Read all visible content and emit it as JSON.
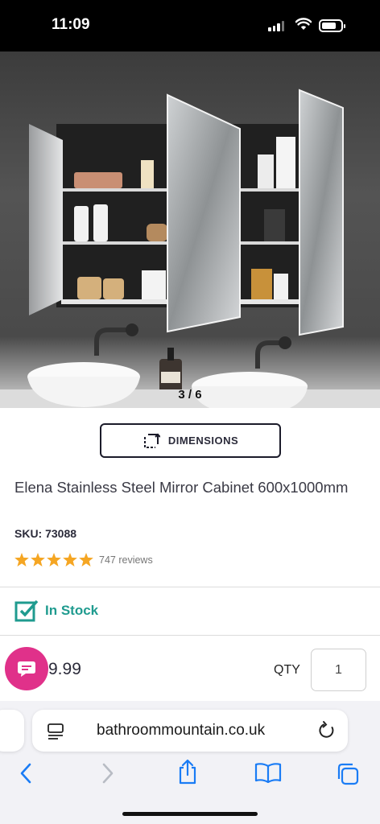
{
  "status_bar": {
    "time": "11:09"
  },
  "gallery": {
    "counter": "3 / 6"
  },
  "product": {
    "dimensions_label": "DIMENSIONS",
    "title": "Elena Stainless Steel Mirror Cabinet 600x1000mm",
    "sku": "SKU: 73088",
    "rating_stars": 5,
    "reviews": "747 reviews",
    "stock": "In Stock",
    "price": "9.99",
    "qty_label": "QTY",
    "qty_value": "1"
  },
  "browser": {
    "url": "bathroommountain.co.uk"
  },
  "colors": {
    "accent_teal": "#1f9b8f",
    "chat_pink": "#e0318a",
    "star": "#f5a623",
    "ios_blue": "#1a7cf5"
  }
}
